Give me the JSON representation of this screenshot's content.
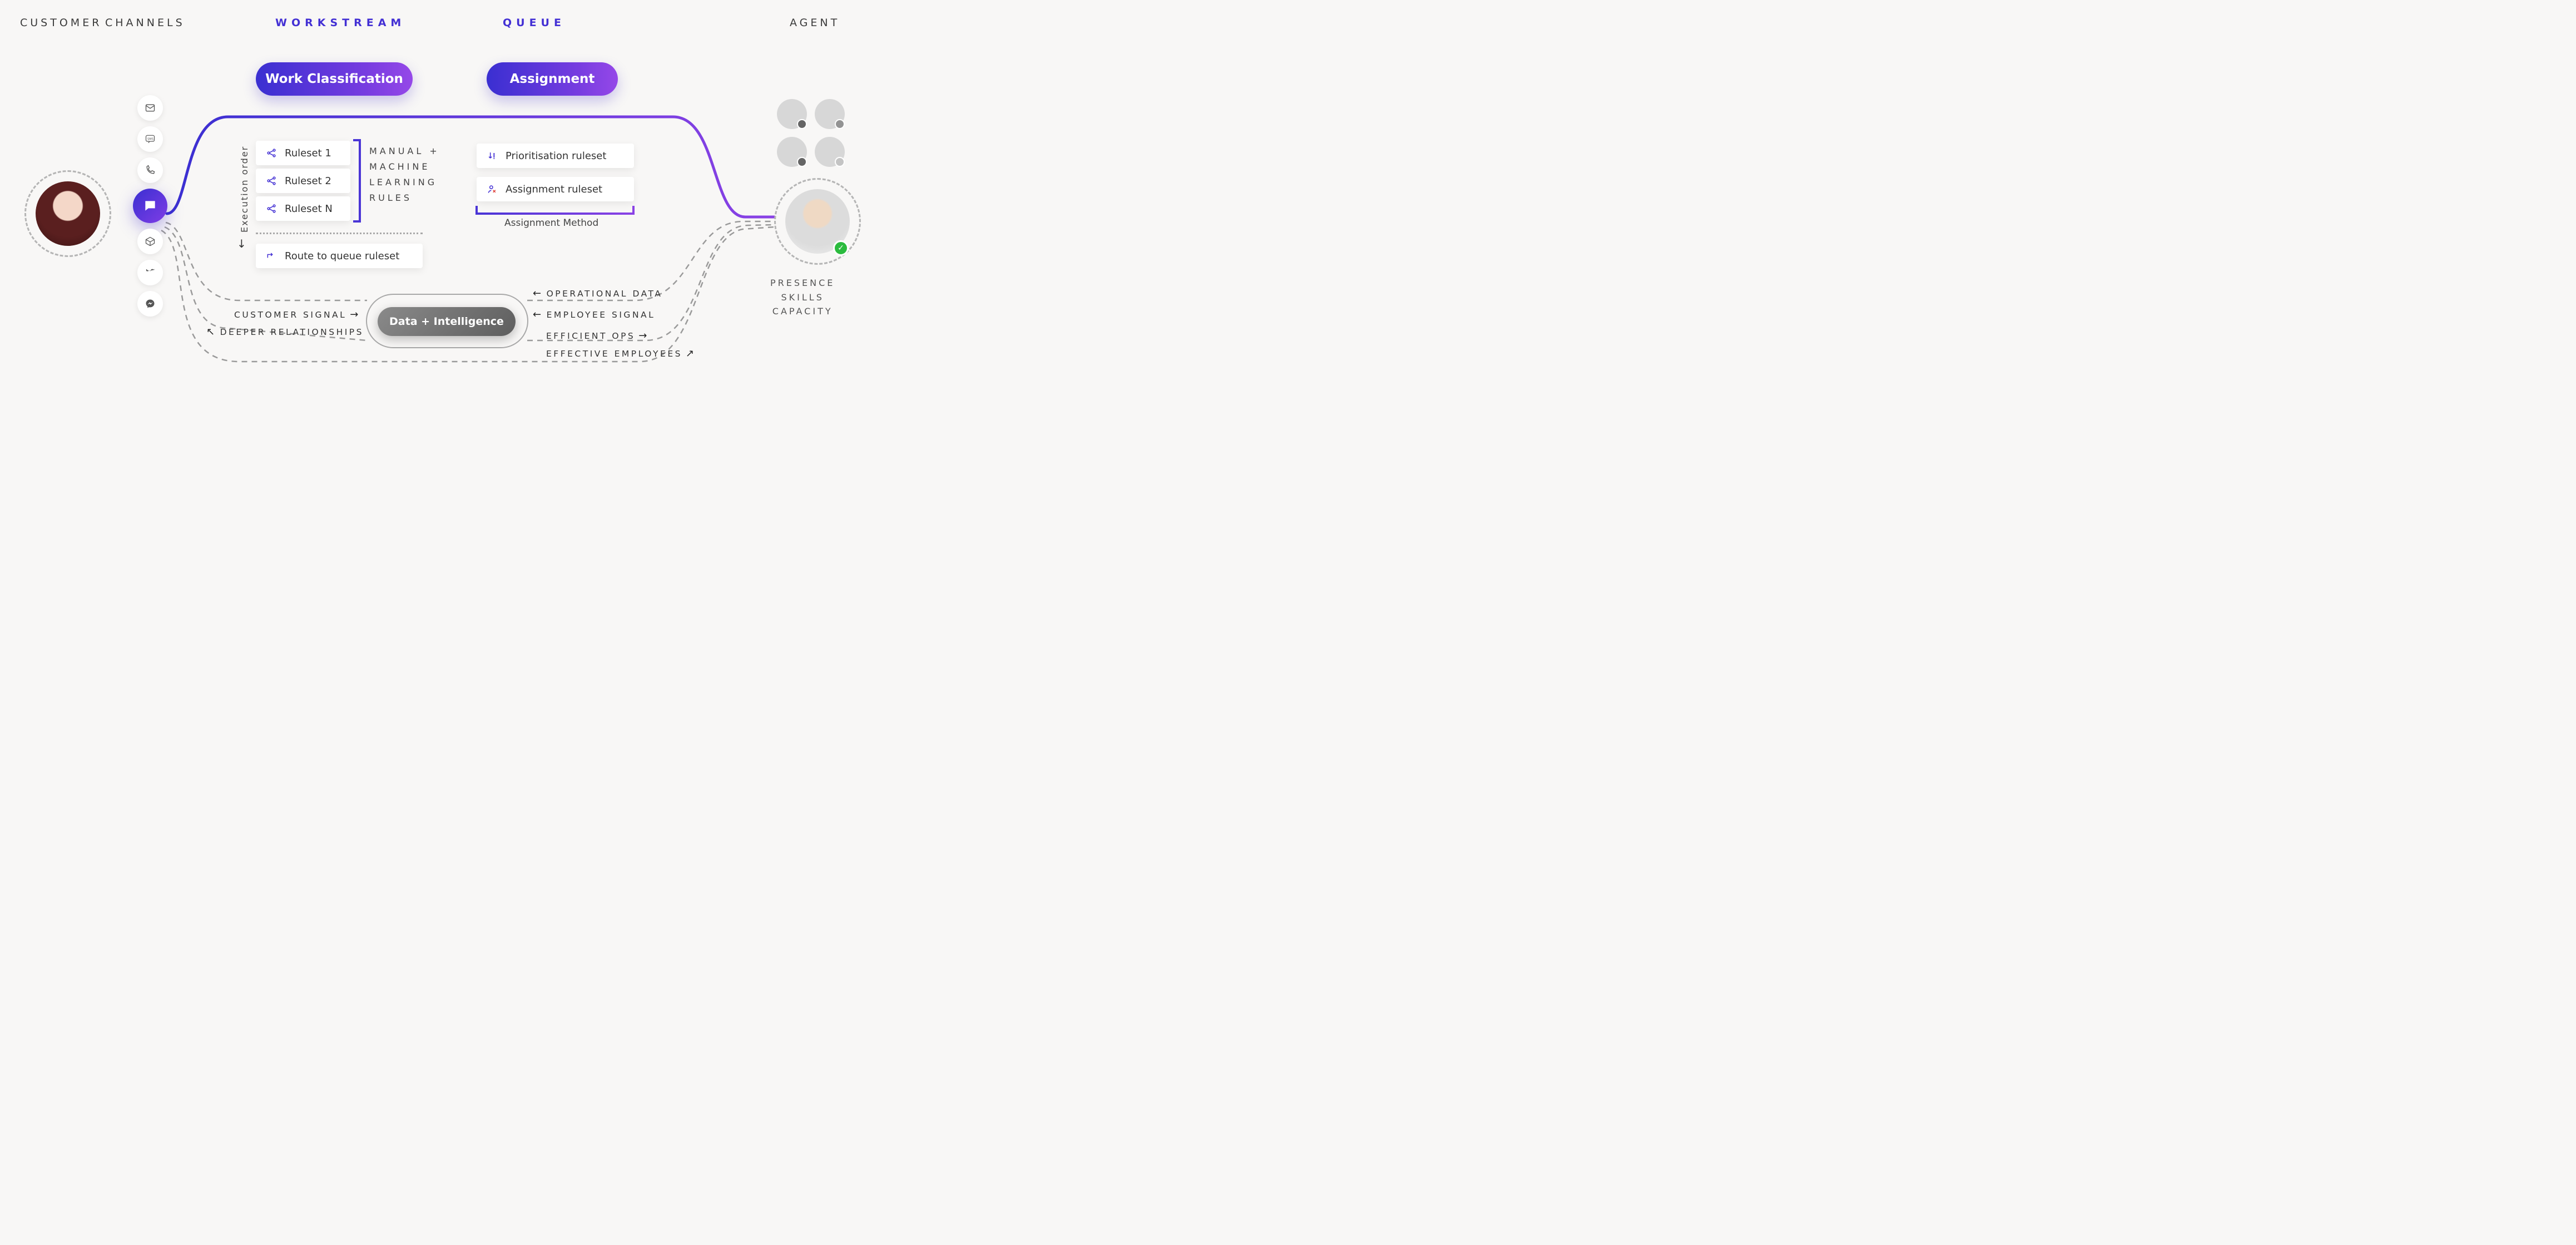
{
  "headers": {
    "customer": "CUSTOMER",
    "channels": "CHANNELS",
    "workstream": "WORKSTREAM",
    "queue": "QUEUE",
    "agent": "AGENT"
  },
  "pills": {
    "workClassification": "Work Classification",
    "assignment": "Assignment"
  },
  "channels": {
    "items": [
      "email",
      "sms",
      "phone",
      "chat",
      "package",
      "twitter",
      "messenger"
    ],
    "activeIndex": 3
  },
  "workstream": {
    "executionOrderLabel": "Execution order",
    "rulesets": [
      "Ruleset 1",
      "Ruleset 2",
      "Ruleset N"
    ],
    "routeLabel": "Route to queue ruleset",
    "manualMlLines": [
      "MANUAL +",
      "MACHINE",
      "LEARNING",
      "RULES"
    ]
  },
  "queue": {
    "prioritisation": "Prioritisation ruleset",
    "assignment": "Assignment ruleset",
    "methodLabel": "Assignment Method"
  },
  "agentMeta": [
    "PRESENCE",
    "SKILLS",
    "CAPACITY"
  ],
  "dataIntel": {
    "pill": "Data + Intelligence",
    "left": [
      "CUSTOMER SIGNAL",
      "DEEPER RELATIONSHIPS"
    ],
    "right": [
      "OPERATIONAL DATA",
      "EMPLOYEE SIGNAL",
      "EFFICIENT OPS",
      "EFFECTIVE EMPLOYEES"
    ]
  },
  "miniAgentStatuses": [
    "r",
    "g",
    "r",
    "y"
  ]
}
